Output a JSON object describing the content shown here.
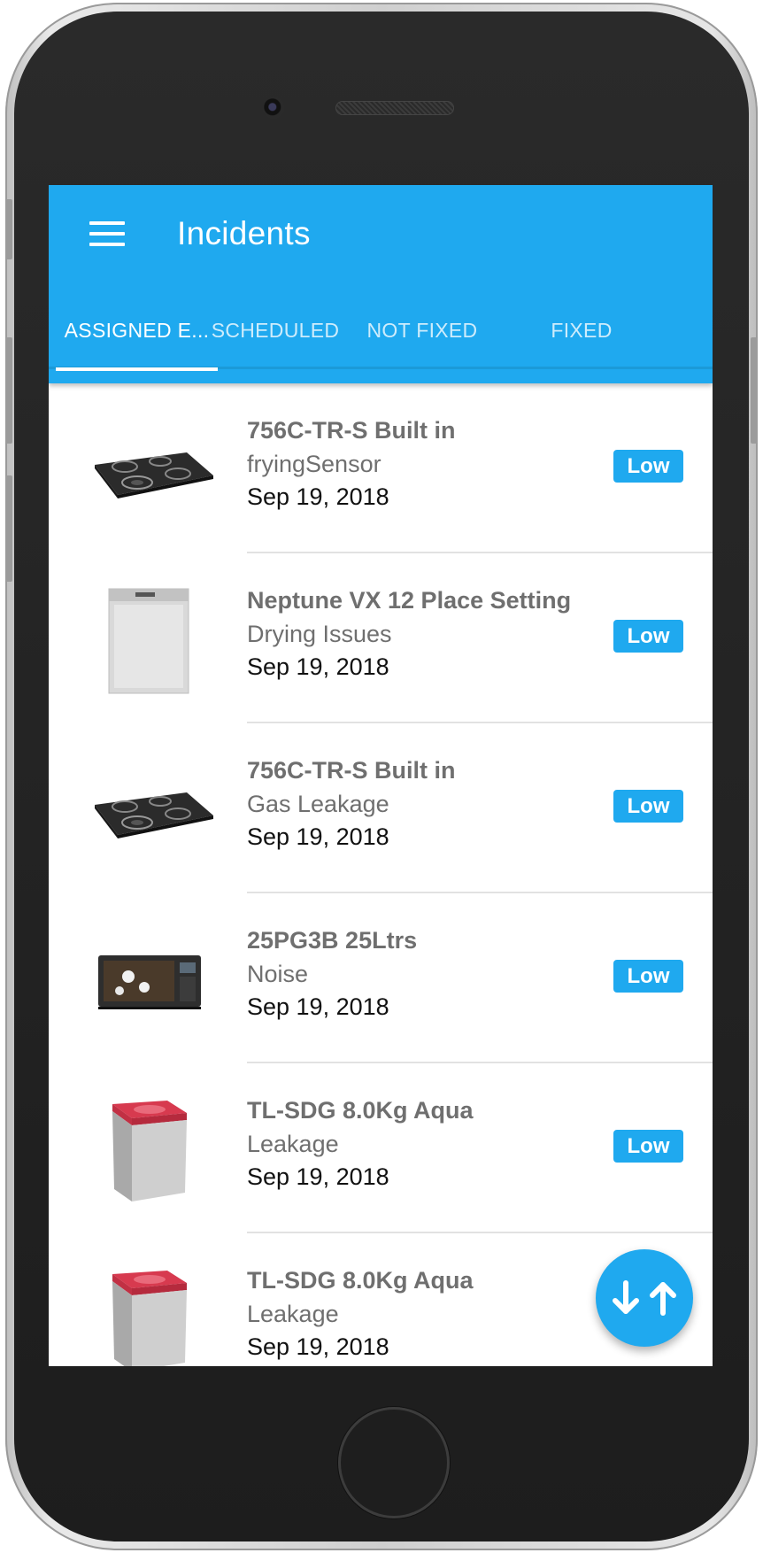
{
  "app_bar": {
    "title": "Incidents",
    "menu_icon": "hamburger-menu-icon",
    "background": "#1fa9ef"
  },
  "tabs": [
    {
      "label": "ASSIGNED E...",
      "active": true
    },
    {
      "label": "SCHEDULED",
      "active": false
    },
    {
      "label": "NOT FIXED",
      "active": false
    },
    {
      "label": "FIXED",
      "active": false
    }
  ],
  "incidents": [
    {
      "product": "756C-TR-S Built in",
      "issue": "fryingSensor",
      "date": "Sep 19, 2018",
      "priority": "Low",
      "image": "gas-hob"
    },
    {
      "product": "Neptune VX 12 Place Setting",
      "issue": "Drying Issues",
      "date": "Sep 19, 2018",
      "priority": "Low",
      "image": "dishwasher"
    },
    {
      "product": "756C-TR-S Built in",
      "issue": "Gas Leakage",
      "date": "Sep 19, 2018",
      "priority": "Low",
      "image": "gas-hob"
    },
    {
      "product": "25PG3B 25Ltrs",
      "issue": "Noise",
      "date": "Sep 19, 2018",
      "priority": "Low",
      "image": "microwave"
    },
    {
      "product": "TL-SDG 8.0Kg Aqua",
      "issue": "Leakage",
      "date": "Sep 19, 2018",
      "priority": "Low",
      "image": "washing-machine"
    },
    {
      "product": "TL-SDG 8.0Kg Aqua",
      "issue": "Leakage",
      "date": "Sep 19, 2018",
      "priority": "",
      "image": "washing-machine"
    }
  ],
  "fab": {
    "icon": "sort-arrows-icon"
  }
}
